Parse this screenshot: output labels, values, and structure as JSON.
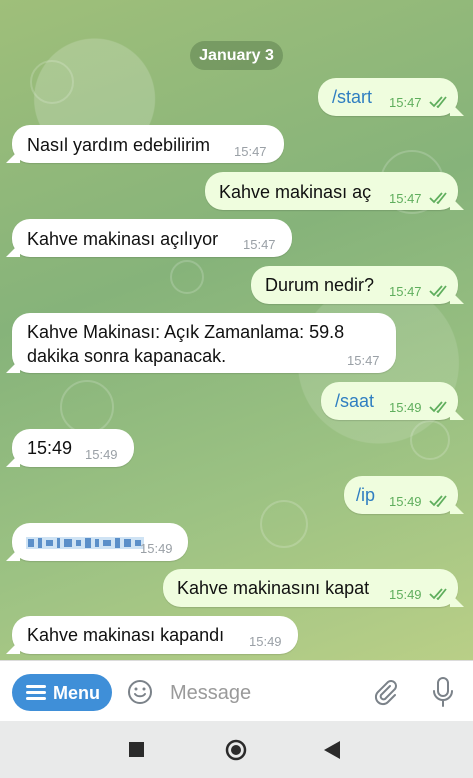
{
  "date_separator": "January 3",
  "messages": [
    {
      "dir": "out",
      "text": "/start",
      "time": "15:47",
      "command": true
    },
    {
      "dir": "in",
      "text": "Nasıl yardım edebilirim",
      "time": "15:47"
    },
    {
      "dir": "out",
      "text": "Kahve makinası aç",
      "time": "15:47"
    },
    {
      "dir": "in",
      "text": "Kahve makinası  açılıyor",
      "time": "15:47"
    },
    {
      "dir": "out",
      "text": "Durum nedir?",
      "time": "15:47"
    },
    {
      "dir": "in",
      "text": "Kahve Makinası: Açık              Zamanlama: 59.8 dakika sonra kapanacak.",
      "time": "15:47"
    },
    {
      "dir": "out",
      "text": "/saat",
      "time": "15:49",
      "command": true
    },
    {
      "dir": "in",
      "text": "15:49",
      "time": "15:49"
    },
    {
      "dir": "out",
      "text": "/ip",
      "time": "15:49",
      "command": true
    },
    {
      "dir": "in",
      "text": "",
      "time": "15:49",
      "redacted": true
    },
    {
      "dir": "out",
      "text": "Kahve makinasını kapat",
      "time": "15:49"
    },
    {
      "dir": "in",
      "text": "Kahve makinası  kapandı",
      "time": "15:49"
    }
  ],
  "composer": {
    "menu_label": "Menu",
    "placeholder": "Message",
    "icons": [
      "menu-icon",
      "emoji-icon",
      "attach-icon",
      "mic-icon"
    ]
  },
  "navbar": {
    "icons": [
      "recents-icon",
      "home-icon",
      "back-icon"
    ]
  },
  "colors": {
    "outgoing_bubble": "#effdde",
    "incoming_bubble": "#ffffff",
    "accent": "#3f8fd8",
    "tick": "#5fae5d"
  }
}
